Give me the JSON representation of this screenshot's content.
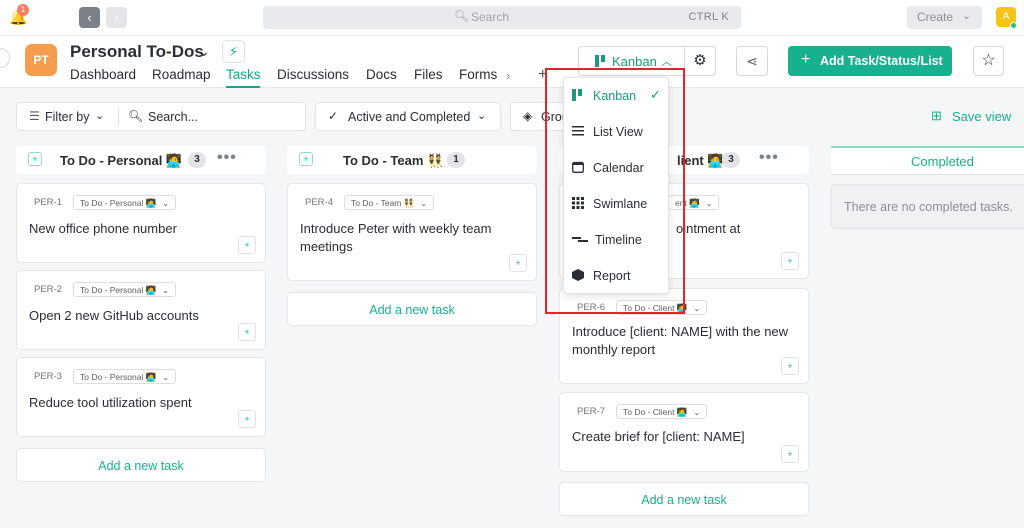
{
  "topbar": {
    "notification_count": "1",
    "search_placeholder": "Search",
    "search_shortcut": "CTRL K",
    "create_label": "Create",
    "user_initial": "A"
  },
  "header": {
    "space_initials": "PT",
    "space_title": "Personal To-Dos",
    "tabs": [
      "Dashboard",
      "Roadmap",
      "Tasks",
      "Discussions",
      "Docs",
      "Files",
      "Forms"
    ],
    "active_tab": "Tasks",
    "view_label": "Kanban",
    "add_task_label": "Add Task/Status/List"
  },
  "filters": {
    "filter_by": "Filter by",
    "search_placeholder": "Search...",
    "active_completed": "Active and Completed",
    "group_by": "Grou",
    "save_view": "Save view"
  },
  "columns": [
    {
      "name": "To Do - Personal 🧑‍💻",
      "count": "3",
      "cards": [
        {
          "id": "PER-1",
          "status": "To Do - Personal 🧑‍💻",
          "title": "New office phone number"
        },
        {
          "id": "PER-2",
          "status": "To Do - Personal 🧑‍💻",
          "title": "Open 2 new GitHub accounts"
        },
        {
          "id": "PER-3",
          "status": "To Do - Personal 🧑‍💻",
          "title": "Reduce tool utilization spent"
        }
      ],
      "add_label": "Add a new task"
    },
    {
      "name": "To Do - Team 👯",
      "count": "1",
      "cards": [
        {
          "id": "PER-4",
          "status": "To Do - Team 👯",
          "title": "Introduce Peter with weekly team meetings"
        }
      ],
      "add_label": "Add a new task"
    },
    {
      "name": "lient 🧑‍💻",
      "count": "3",
      "cards": [
        {
          "id": "",
          "status": "ent 🧑‍💻",
          "title": "ointment at"
        },
        {
          "id": "PER-6",
          "status": "To Do - Client 🧑‍💻",
          "title": "Introduce [client: NAME] with the new monthly report"
        },
        {
          "id": "PER-7",
          "status": "To Do - Client 🧑‍💻",
          "title": "Create brief for [client: NAME]"
        }
      ],
      "add_label": "Add a new task"
    }
  ],
  "completed": {
    "name": "Completed",
    "empty_text": "There are no completed tasks."
  },
  "view_menu": {
    "items": [
      {
        "label": "Kanban",
        "icon": "kanban-icon",
        "selected": true
      },
      {
        "label": "List View",
        "icon": "list-icon",
        "selected": false
      },
      {
        "label": "Calendar",
        "icon": "calendar-icon",
        "selected": false
      },
      {
        "label": "Swimlane",
        "icon": "swimlane-icon",
        "selected": false
      },
      {
        "label": "Timeline",
        "icon": "timeline-icon",
        "selected": false
      },
      {
        "label": "Report",
        "icon": "report-icon",
        "selected": false
      }
    ]
  },
  "colors": {
    "accent": "#17b18e",
    "highlight": "#e3252b",
    "space_avatar": "#f49d4c"
  }
}
